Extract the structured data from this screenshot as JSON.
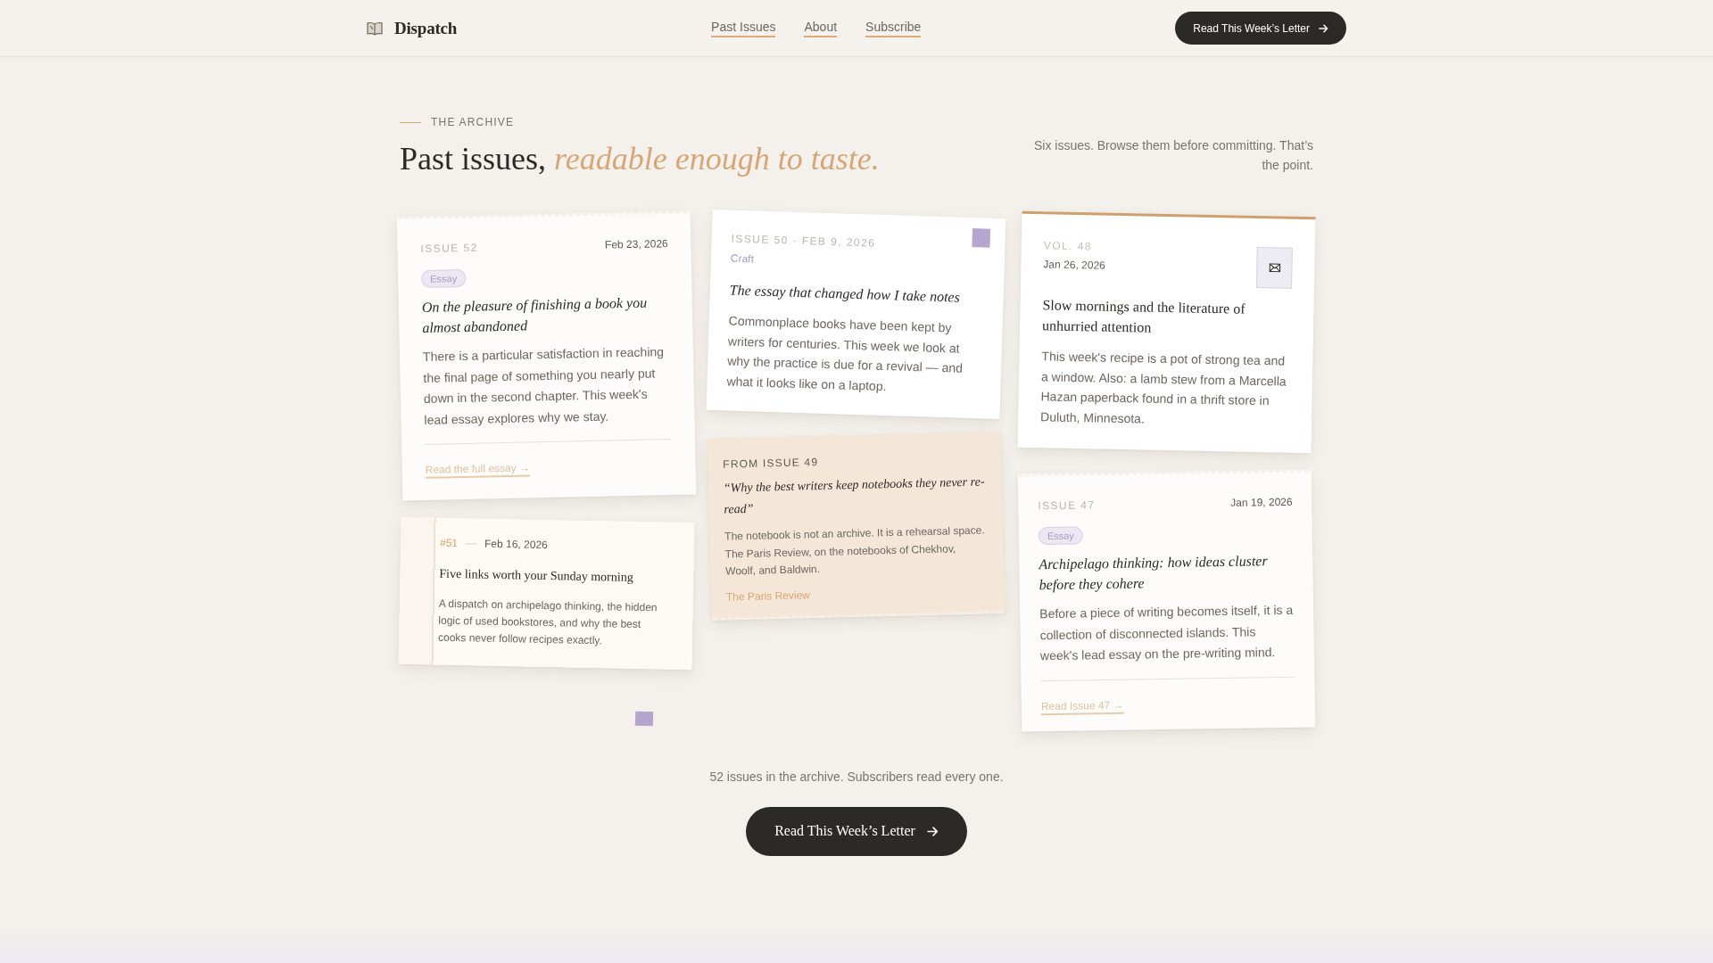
{
  "header": {
    "brand": "Dispatch",
    "nav": [
      {
        "label": "Past Issues"
      },
      {
        "label": "About"
      },
      {
        "label": "Subscribe"
      }
    ],
    "cta": "Read This Week’s Letter"
  },
  "intro": {
    "eyebrow": "THE ARCHIVE",
    "title": "Past issues, *readable enough to taste.*",
    "summary": "Six issues. Browse them before committing. That’s the point."
  },
  "columns": [
    [
      {
        "kind": "essay",
        "issue": "ISSUE 52",
        "date": "Feb 23, 2026",
        "tag": "Essay",
        "title": "On the pleasure of finishing a book you almost abandoned",
        "body": "There is a particular satisfaction in reaching the final page of something you nearly put down in the second chapter. This week's lead essay explores why we stay.",
        "link": "Read the full essay →"
      },
      {
        "kind": "digest",
        "number": "#51",
        "date": "Feb 16, 2026",
        "title": "Five links worth your Sunday morning",
        "body": "A dispatch on archipelago thinking, the hidden logic of used bookstores, and why the best cooks never follow recipes exactly."
      }
    ],
    [
      {
        "kind": "note",
        "meta": "ISSUE 50 · FEB 9, 2026",
        "category": "Craft",
        "title": "The essay that changed how I take notes",
        "body": "Commonplace books have been kept by writers for centuries. This week we look at why the practice is due for a revival — and what it looks like on a laptop."
      },
      {
        "kind": "quote",
        "label": "FROM ISSUE 49",
        "quote": "“Why the best writers keep notebooks they never re-read”",
        "body": "The notebook is not an archive. It is a rehearsal space. The Paris Review, on the notebooks of Chekhov, Woolf, and Baldwin.",
        "source": "The Paris Review"
      }
    ],
    [
      {
        "kind": "letter",
        "volume": "VOL. 48",
        "date": "Jan 26, 2026",
        "title": "Slow mornings and the literature of unhurried attention",
        "body": "This week's recipe is a pot of strong tea and a window. Also: a lamb stew from a Marcella Hazan paperback found in a thrift store in Duluth, Minnesota."
      },
      {
        "kind": "essay",
        "issue": "ISSUE 47",
        "date": "Jan 19, 2026",
        "tag": "Essay",
        "title": "Archipelago thinking: how ideas cluster before they cohere",
        "body": "Before a piece of writing becomes itself, it is a collection of disconnected islands. This week's lead essay on the pre-writing mind.",
        "link": "Read Issue 47 →"
      }
    ]
  ],
  "footer": {
    "note": "52 issues in the archive. Subscribers read every one.",
    "cta": "Read This Week’s Letter"
  }
}
